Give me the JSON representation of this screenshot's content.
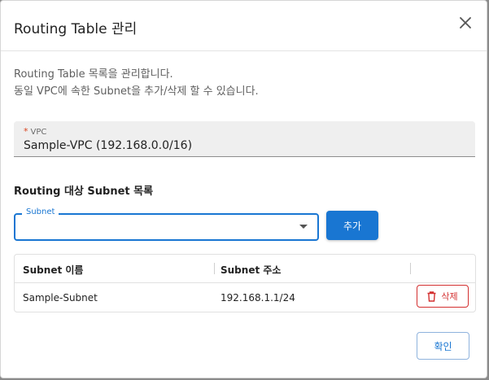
{
  "dialog": {
    "title": "Routing Table 관리",
    "description_line1": "Routing Table 목록을 관리합니다.",
    "description_line2": "동일 VPC에 속한 Subnet을 추가/삭제 할 수 있습니다."
  },
  "vpc_field": {
    "required_mark": "*",
    "label": "VPC",
    "value": "Sample-VPC (192.168.0.0/16)"
  },
  "subnet_section": {
    "title": "Routing 대상 Subnet 목록",
    "select_label": "Subnet",
    "select_value": "",
    "add_button": "추가"
  },
  "table": {
    "columns": [
      "Subnet 이름",
      "Subnet 주소"
    ],
    "rows": [
      {
        "name": "Sample-Subnet",
        "address": "192.168.1.1/24",
        "delete_label": "삭제"
      }
    ]
  },
  "footer": {
    "confirm_button": "확인"
  },
  "colors": {
    "primary": "#1976d2",
    "danger": "#d32f2f",
    "required": "#d9431e"
  },
  "icons": {
    "close": "close-icon",
    "delete": "trash-icon",
    "dropdown": "caret-down-icon"
  }
}
